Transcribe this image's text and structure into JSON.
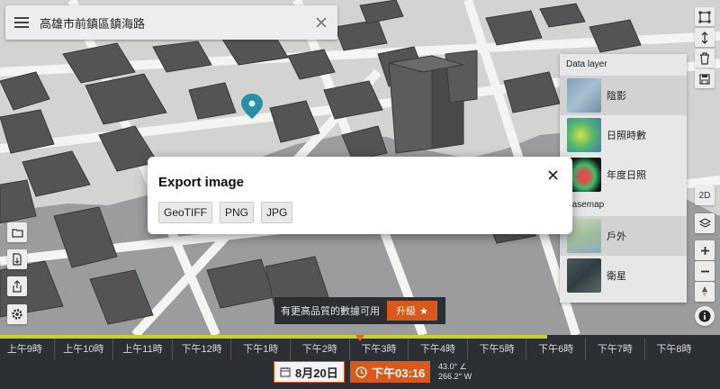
{
  "search": {
    "query": "高雄市前鎮區鎮海路"
  },
  "panel": {
    "data_layer_title": "Data layer",
    "data_layers": [
      {
        "label": "陰影",
        "icon": "shadow-thumb-icon",
        "selected": true
      },
      {
        "label": "日照時數",
        "icon": "sun-hours-thumb-icon",
        "selected": false
      },
      {
        "label": "年度日照",
        "icon": "annual-sun-thumb-icon",
        "selected": false
      }
    ],
    "basemap_title": "Basemap",
    "basemaps": [
      {
        "label": "戶外",
        "icon": "outdoor-thumb-icon",
        "selected": true
      },
      {
        "label": "衛星",
        "icon": "satellite-thumb-icon",
        "selected": false
      }
    ]
  },
  "view_toggle": "2D",
  "upgrade": {
    "text": "有更高品質的數據可用",
    "button": "升級"
  },
  "timeline": {
    "progress": 0.76,
    "marker_fraction": 0.5,
    "ticks": [
      "上午9時",
      "上午10時",
      "上午11時",
      "下午12時",
      "下午1時",
      "下午2時",
      "下午3時",
      "下午4時",
      "下午5時",
      "下午6時",
      "下午7時",
      "下午8時"
    ],
    "date": "8月20日",
    "time": "下午03:16",
    "sun_altitude": "43.0° ∠",
    "sun_azimuth": "266.2° W"
  },
  "modal": {
    "title": "Export image",
    "formats": [
      "GeoTIFF",
      "PNG",
      "JPG"
    ]
  },
  "colors": {
    "accent": "#d9581a",
    "timeline_bg": "#2c2f33",
    "timeline_progress": "#c7d32c",
    "pin": "#2a8ea5"
  }
}
